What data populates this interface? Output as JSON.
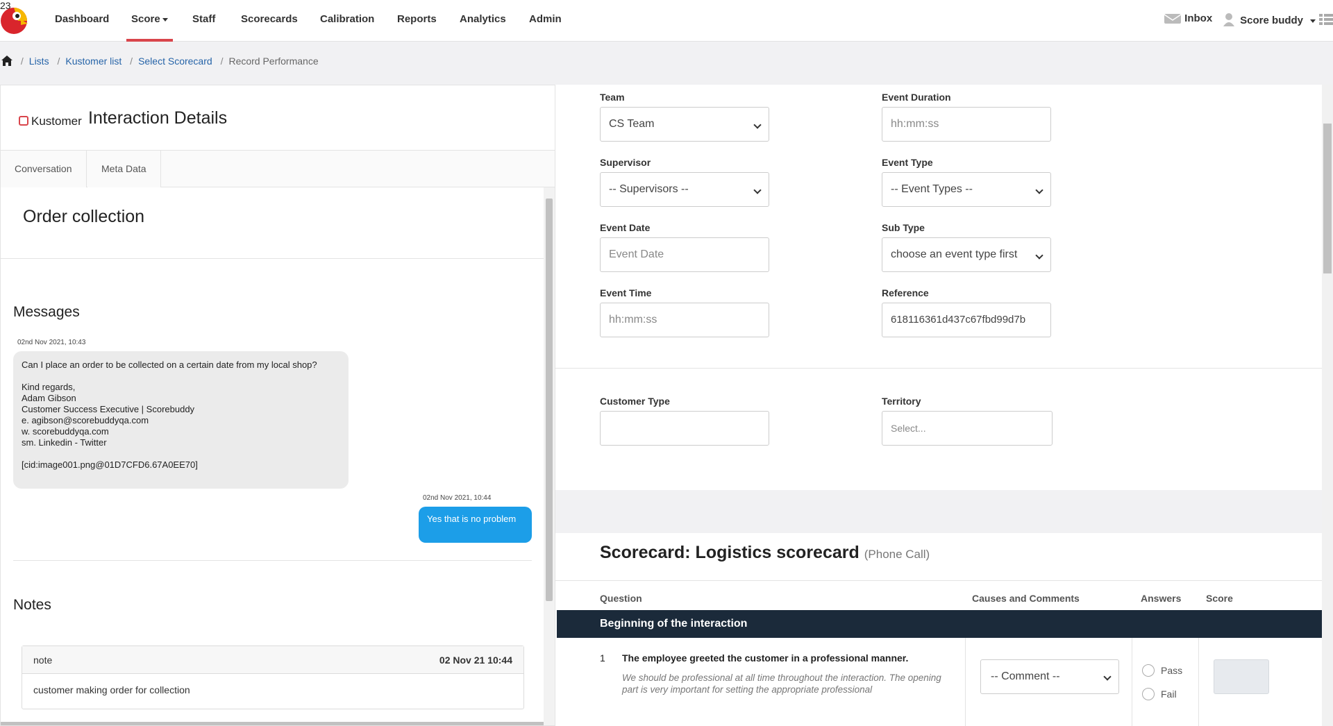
{
  "nav": {
    "items": [
      "Dashboard",
      "Score",
      "Staff",
      "Scorecards",
      "Calibration",
      "Reports",
      "Analytics",
      "Admin"
    ],
    "active": "Score",
    "inbox_label": "Inbox",
    "inbox_count": "23",
    "user_label": "Score buddy"
  },
  "breadcrumb": {
    "items": [
      "Lists",
      "Kustomer list",
      "Select Scorecard"
    ],
    "current": "Record Performance"
  },
  "left": {
    "brand": "Kustomer",
    "title": "Interaction Details",
    "tabs": [
      "Conversation",
      "Meta Data"
    ],
    "conversation_title": "Order collection",
    "messages_title": "Messages",
    "messages": [
      {
        "timestamp": "02nd Nov 2021, 10:43",
        "text": "Can I place an order to be collected on a certain date from my local shop?\n\nKind regards,\nAdam Gibson\nCustomer Success Executive | Scorebuddy\ne. agibson@scorebuddyqa.com\nw. scorebuddyqa.com\nsm. Linkedin - Twitter\n\n[cid:image001.png@01D7CFD6.67A0EE70]"
      },
      {
        "timestamp": "02nd Nov 2021, 10:44",
        "text": "Yes that is no problem"
      }
    ],
    "notes_title": "Notes",
    "note": {
      "label": "note",
      "date": "02 Nov 21 10:44",
      "body": "customer making order for collection"
    }
  },
  "form": {
    "team": {
      "label": "Team",
      "value": "CS Team"
    },
    "event_duration": {
      "label": "Event Duration",
      "placeholder": "hh:mm:ss"
    },
    "supervisor": {
      "label": "Supervisor",
      "value": "-- Supervisors --"
    },
    "event_type": {
      "label": "Event Type",
      "value": "-- Event Types --"
    },
    "event_date": {
      "label": "Event Date",
      "placeholder": "Event Date"
    },
    "sub_type": {
      "label": "Sub Type",
      "value": "choose an event type first"
    },
    "event_time": {
      "label": "Event Time",
      "placeholder": "hh:mm:ss"
    },
    "reference": {
      "label": "Reference",
      "value": "618116361d437c67fbd99d7b"
    },
    "customer_type": {
      "label": "Customer Type",
      "value": ""
    },
    "territory": {
      "label": "Territory",
      "placeholder": "Select..."
    }
  },
  "scorecard": {
    "title": "Scorecard: Logistics scorecard",
    "subtitle": "(Phone Call)",
    "headers": {
      "question": "Question",
      "comments": "Causes and Comments",
      "answers": "Answers",
      "score": "Score"
    },
    "section": "Beginning of the interaction",
    "question": {
      "num": "1",
      "text": "The employee greeted the customer in a professional manner.",
      "desc": "We should be professional at all time throughout the interaction. The opening part is very important for setting the appropriate professional",
      "comment_value": "-- Comment --",
      "options": [
        "Pass",
        "Fail"
      ]
    }
  },
  "colors": {
    "accent": "#d9454b",
    "link": "#2664a8",
    "bubble_out": "#1c9ee8",
    "section_bar": "#1b2a3a"
  }
}
